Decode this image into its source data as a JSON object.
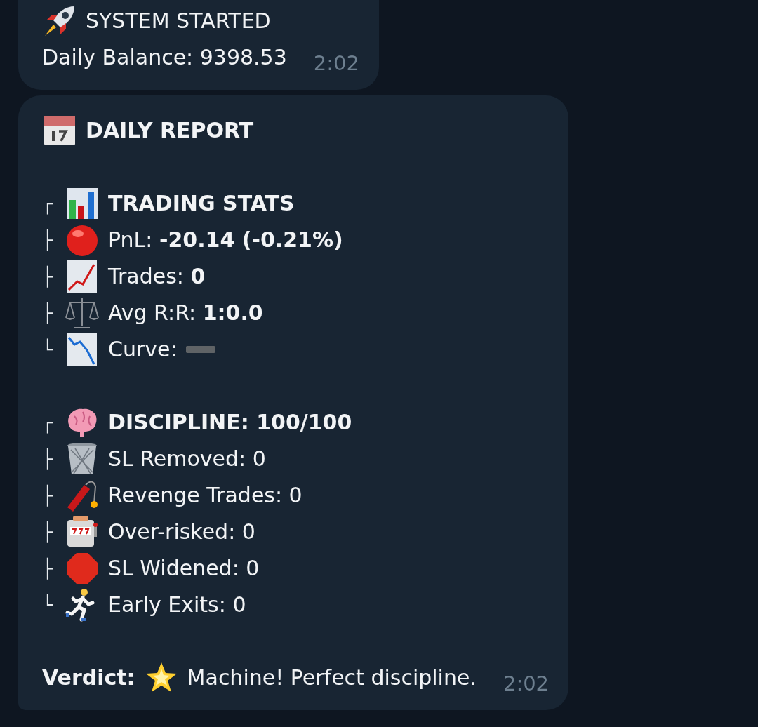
{
  "messages": [
    {
      "kind": "notice",
      "title": "SYSTEM STARTED",
      "body": "Daily Balance: 9398.53",
      "time": "2:02"
    },
    {
      "kind": "report",
      "title": "DAILY REPORT",
      "sections": [
        {
          "rows": [
            {
              "kind": "heading",
              "branch": "┌",
              "text": "TRADING STATS"
            },
            {
              "kind": "stat",
              "branch": "├",
              "text": "PnL: **-20.14 (-0.21%)**"
            },
            {
              "kind": "stat",
              "branch": "├",
              "text": "Trades: **0**"
            },
            {
              "kind": "stat",
              "branch": "├",
              "text": "Avg R:R: **1:0.0**"
            },
            {
              "kind": "curve",
              "branch": "└",
              "text": "Curve:"
            }
          ]
        },
        {
          "rows": [
            {
              "kind": "heading",
              "branch": "┌",
              "text": "DISCIPLINE: 100/100"
            },
            {
              "kind": "stat",
              "branch": "├",
              "text": "SL Removed: 0"
            },
            {
              "kind": "stat",
              "branch": "├",
              "text": "Revenge Trades: 0"
            },
            {
              "kind": "stat",
              "branch": "├",
              "text": "Over-risked: 0"
            },
            {
              "kind": "stat",
              "branch": "├",
              "text": "SL Widened: 0"
            },
            {
              "kind": "stat",
              "branch": "└",
              "text": "Early Exits: 0"
            }
          ]
        }
      ],
      "verdict": {
        "label": "Verdict:",
        "text": "Machine! Perfect discipline."
      },
      "time": "2:02"
    }
  ]
}
